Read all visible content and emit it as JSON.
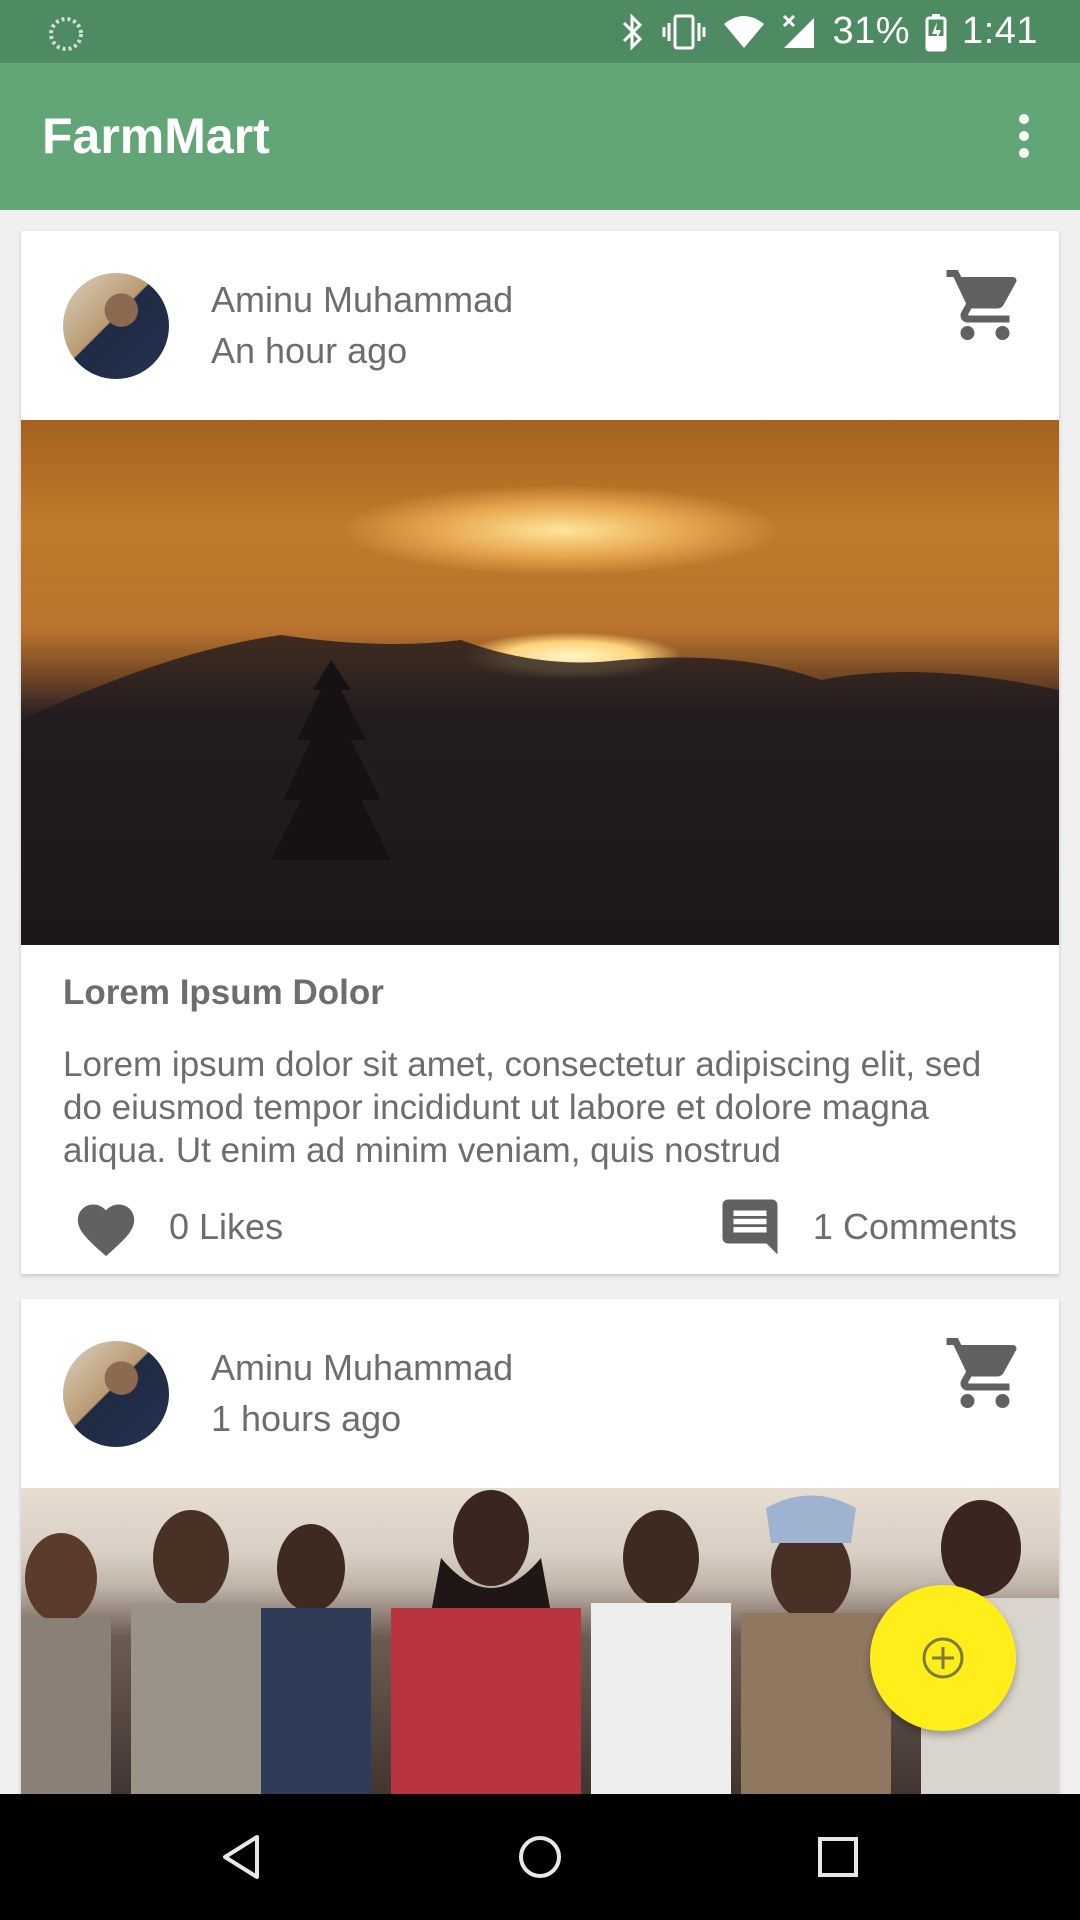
{
  "status_bar": {
    "battery": "31%",
    "time": "1:41",
    "icons": [
      "loading-icon",
      "bluetooth-icon",
      "vibrate-icon",
      "wifi-icon",
      "signal-icon",
      "battery-charging-icon"
    ]
  },
  "app_bar": {
    "title": "FarmMart",
    "menu_icon": "more-vert-icon"
  },
  "posts": [
    {
      "author": "Aminu Muhammad",
      "time": "An hour ago",
      "title": "Lorem Ipsum Dolor",
      "body": "Lorem ipsum dolor sit amet, consectetur adipiscing elit, sed do eiusmod tempor incididunt ut labore et dolore magna aliqua. Ut enim ad minim veniam, quis nostrud",
      "likes": "0 Likes",
      "comments": "1 Comments",
      "image": "sunset-photo"
    },
    {
      "author": "Aminu Muhammad",
      "time": "1 hours ago",
      "image": "group-photo"
    }
  ],
  "fab_icon": "add-circle-icon",
  "colors": {
    "status_bar": "#4e8a62",
    "app_bar": "#62a678",
    "fab": "#ffee1a",
    "nav_bar": "#000000"
  },
  "nav": [
    "back-icon",
    "home-icon",
    "recents-icon"
  ]
}
